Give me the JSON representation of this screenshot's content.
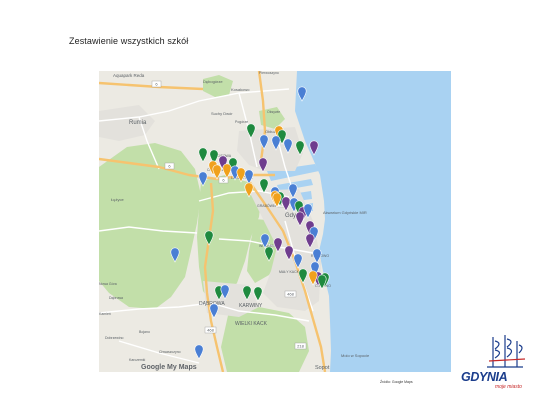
{
  "title": "Zestawienie wszystkich szkół",
  "map": {
    "labels": {
      "aquapark": "Aquapark Reda",
      "rumia": "Rumia",
      "debogorze": "Dębogórze",
      "kosakowo": "Kosakowo",
      "pierwoszyno": "Pierwoszyno",
      "suchy_dwor": "Suchy Dwór",
      "oksywie": "Oksywie",
      "pogorze": "Pogórze",
      "obluze": "Obłuże",
      "gdynia": "Gdynia",
      "akwarium": "Akwarium Gdyńskie MIR",
      "grabowek": "GRABÓWEK",
      "leszczynki": "LESZCZYNKI",
      "chylonia": "CHYLONIA",
      "cisowa": "CISOWA",
      "witomino": "WITOMINO",
      "redlowo": "REDŁOWO",
      "orlowo": "ORŁOWO",
      "maly_kack": "MAŁY KACK",
      "dabrowa": "DĄBROWA",
      "karwiny": "KARWINY",
      "wielki_kack": "WIELKI KACK",
      "sopot": "Sopot",
      "molo": "Molo w Sopocie",
      "lezyce": "Łężyce",
      "dobrzewino": "Dobrzewino",
      "bojano": "Bojano",
      "chwaszczyno": "Chwaszczyno",
      "karczemki": "Karczemki",
      "nowa_gora": "Nowa Góra",
      "kamien": "Kamień",
      "dabrowa2": "Dąbrowa"
    },
    "road_numbers": [
      "6",
      "6",
      "6",
      "20",
      "468",
      "468",
      "218"
    ],
    "google_logo": "Google My Maps",
    "colors": {
      "land": "#eceae3",
      "sea": "#a9d2f2",
      "forest": "#c2dfa9",
      "urban": "#e3e1dc",
      "highway": "#f6c36f",
      "road": "#ffffff",
      "blue_pin": "#4a7fd4",
      "green_pin": "#1f8a3f",
      "orange_pin": "#f0a11c",
      "purple_pin": "#6f3d8e"
    },
    "pin_colors_shown": [
      "blue",
      "green",
      "orange",
      "purple"
    ]
  },
  "attribution": "Źródło: Google Maps",
  "logo": {
    "word": "GDYNIA",
    "tagline": "moje miasto"
  }
}
